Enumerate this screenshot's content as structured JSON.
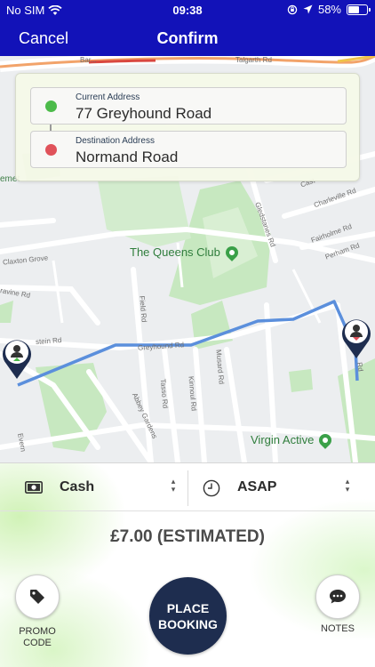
{
  "status_bar": {
    "carrier": "No SIM",
    "time": "09:38",
    "battery": "58%",
    "battery_level": 0.58
  },
  "nav": {
    "cancel_label": "Cancel",
    "title": "Confirm"
  },
  "addresses": {
    "current": {
      "label": "Current Address",
      "value": "77 Greyhound Road"
    },
    "destination": {
      "label": "Destination Address",
      "value": "Normand Road"
    }
  },
  "map": {
    "poi": {
      "queens_club": "The Queens Club",
      "virgin_active": "Virgin Active"
    },
    "streets": {
      "greyhound_rd": "Greyhound Rd",
      "field_rd": "Field Rd",
      "tasso_rd": "Tasso Rd",
      "kinnoul_rd": "Kinnoul Rd",
      "musard_rd": "Musard Rd",
      "abbey_gardens": "Abbey Gardens",
      "gledstanes_rd": "Gledstanes Rd",
      "charleville_rd": "Charleville Rd",
      "fairholme_rd": "Fairholme Rd",
      "perham_rd": "Perham Rd",
      "claxton_grove": "Claxton Grove",
      "ravine_rd": "ravine Rd",
      "stein_rd": "stein Rd",
      "cast": "Cast",
      "rd_right": "Rd",
      "everin": "Evern",
      "cemetery": "emet",
      "talgarth": "Talgarth Rd",
      "barons": "Bar..."
    }
  },
  "booking": {
    "payment": {
      "icon": "cash-icon",
      "value": "Cash"
    },
    "time": {
      "icon": "clock-icon",
      "value": "ASAP"
    },
    "price": "£7.00 (ESTIMATED)",
    "promo_label": "PROMO CODE",
    "place_label": "PLACE\nBOOKING",
    "notes_label": "NOTES"
  },
  "colors": {
    "nav_bar": "#1212b8",
    "current_dot": "#4cbb4a",
    "destination_dot": "#e0525a",
    "place_button": "#1e2d4f",
    "route": "#5b8fdc",
    "park": "#c7e8c0",
    "poi_text": "#2f7d3c"
  }
}
